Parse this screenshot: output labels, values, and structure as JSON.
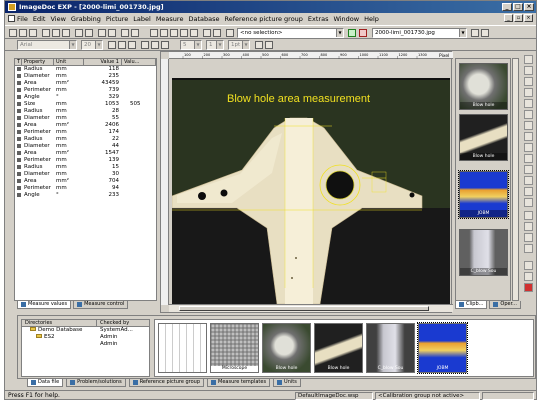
{
  "window": {
    "title": "ImageDoc EXP - [2000-limi_001730.jpg]",
    "min": "_",
    "max": "□",
    "close": "×"
  },
  "menu": [
    "File",
    "Edit",
    "View",
    "Grabbing",
    "Picture",
    "Label",
    "Measure",
    "Database",
    "Reference picture group",
    "Extras",
    "Window",
    "Help"
  ],
  "toolbar": {
    "selection_value": "<no selection>",
    "file_value": "2000-limi_001730.jpg",
    "font_value": "Arial",
    "size_value": "20",
    "zoom_value": "5",
    "line_value": "1",
    "stroke_value": "1pt"
  },
  "properties": {
    "headers": [
      "T",
      "Property",
      "Unit",
      "Value 1",
      "Valu..."
    ],
    "rows": [
      {
        "property": "Radius",
        "unit": "mm",
        "value1": "118",
        "value2": ""
      },
      {
        "property": "Diameter",
        "unit": "mm",
        "value1": "235",
        "value2": ""
      },
      {
        "property": "Area",
        "unit": "mm²",
        "value1": "43459",
        "value2": ""
      },
      {
        "property": "Perimeter",
        "unit": "mm",
        "value1": "739",
        "value2": ""
      },
      {
        "property": "Angle",
        "unit": "°",
        "value1": "329",
        "value2": ""
      },
      {
        "property": "Size",
        "unit": "mm",
        "value1": "1053",
        "value2": "505"
      },
      {
        "property": "Radius",
        "unit": "mm",
        "value1": "28",
        "value2": ""
      },
      {
        "property": "Diameter",
        "unit": "mm",
        "value1": "55",
        "value2": ""
      },
      {
        "property": "Area",
        "unit": "mm²",
        "value1": "2406",
        "value2": ""
      },
      {
        "property": "Perimeter",
        "unit": "mm",
        "value1": "174",
        "value2": ""
      },
      {
        "property": "Radius",
        "unit": "mm",
        "value1": "22",
        "value2": ""
      },
      {
        "property": "Diameter",
        "unit": "mm",
        "value1": "44",
        "value2": ""
      },
      {
        "property": "Area",
        "unit": "mm²",
        "value1": "1547",
        "value2": ""
      },
      {
        "property": "Perimeter",
        "unit": "mm",
        "value1": "139",
        "value2": ""
      },
      {
        "property": "Radius",
        "unit": "mm",
        "value1": "15",
        "value2": ""
      },
      {
        "property": "Diameter",
        "unit": "mm",
        "value1": "30",
        "value2": ""
      },
      {
        "property": "Area",
        "unit": "mm²",
        "value1": "704",
        "value2": ""
      },
      {
        "property": "Perimeter",
        "unit": "mm",
        "value1": "94",
        "value2": ""
      },
      {
        "property": "Angle",
        "unit": "°",
        "value1": "233",
        "value2": ""
      }
    ]
  },
  "left_tabs": [
    "Measure values",
    "Measure control"
  ],
  "image": {
    "annotation": "Blow hole area measurement",
    "ruler_unit": "Pixel",
    "ruler_ticks": [
      "100",
      "200",
      "300",
      "400",
      "500",
      "600",
      "700",
      "800",
      "900",
      "1000",
      "1100",
      "1200",
      "1300"
    ]
  },
  "right_thumbs": [
    "Blow hole",
    "Blow hole",
    "JOBM",
    "C_blow Sou"
  ],
  "right_tabs": [
    "Clipb...",
    "Oper..."
  ],
  "directories": {
    "headers": [
      "Directories",
      "Checked by"
    ],
    "rows": [
      {
        "name": "Demo Database",
        "checked": "SystemAd..."
      },
      {
        "name": "ES2",
        "checked": "Admin"
      },
      {
        "name": "",
        "checked": "Admin"
      }
    ]
  },
  "strip_thumbs": [
    "",
    "Microscope",
    "Blow hole",
    "Blow hole",
    "C_blow Sou",
    "JOBM"
  ],
  "bottom_tabs": [
    "Data file",
    "Problem/solutions",
    "Reference picture group",
    "Measure templates",
    "Units"
  ],
  "status": {
    "help": "Press F1 for help.",
    "workspace": "DefaultImageDoc.wsp",
    "calibration": "<Calibration group not active>"
  },
  "colors": {
    "title_bar": "#0a246a",
    "annotation_text": "#f0e020",
    "selection_thumb_bg": "#1a3ad0"
  }
}
